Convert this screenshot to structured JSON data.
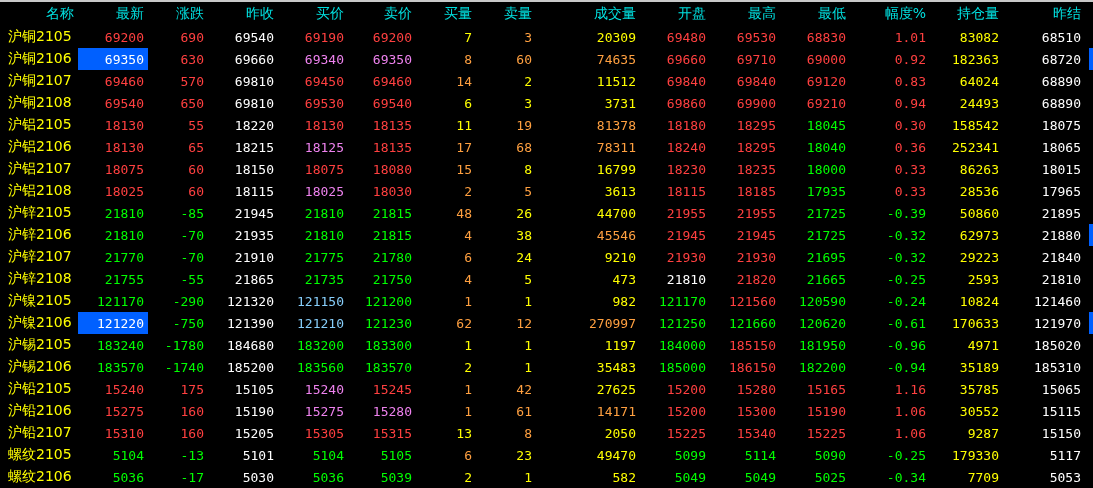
{
  "columns": [
    "名称",
    "最新",
    "涨跌",
    "昨收",
    "买价",
    "卖价",
    "买量",
    "卖量",
    "成交量",
    "开盘",
    "最高",
    "最低",
    "幅度%",
    "持仓量",
    "昨结"
  ],
  "rows": [
    {
      "name": "沪铜2105",
      "selected": false,
      "marked": false,
      "cells": [
        {
          "text": "69200",
          "color": "#ff4040"
        },
        {
          "text": "690",
          "color": "#ff4040"
        },
        {
          "text": "69540",
          "color": "#ffffff"
        },
        {
          "text": "69190",
          "color": "#ff4040"
        },
        {
          "text": "69200",
          "color": "#ff4040"
        },
        {
          "text": "7",
          "color": "#ffff00"
        },
        {
          "text": "3",
          "color": "#ffa040"
        },
        {
          "text": "20309",
          "color": "#ffff00"
        },
        {
          "text": "69480",
          "color": "#ff4040"
        },
        {
          "text": "69530",
          "color": "#ff4040"
        },
        {
          "text": "68830",
          "color": "#ff4040"
        },
        {
          "text": "1.01",
          "color": "#ff4040"
        },
        {
          "text": "83082",
          "color": "#ffff00"
        },
        {
          "text": "68510",
          "color": "#ffffff"
        }
      ]
    },
    {
      "name": "沪铜2106",
      "selected": true,
      "marked": true,
      "cells": [
        {
          "text": "69350",
          "color": "#ffffff"
        },
        {
          "text": "630",
          "color": "#ff4040"
        },
        {
          "text": "69660",
          "color": "#ffffff"
        },
        {
          "text": "69340",
          "color": "#ee82ee"
        },
        {
          "text": "69350",
          "color": "#ee82ee"
        },
        {
          "text": "8",
          "color": "#ffa040"
        },
        {
          "text": "60",
          "color": "#ffa040"
        },
        {
          "text": "74635",
          "color": "#ffa040"
        },
        {
          "text": "69660",
          "color": "#ff4040"
        },
        {
          "text": "69710",
          "color": "#ff4040"
        },
        {
          "text": "69000",
          "color": "#ff4040"
        },
        {
          "text": "0.92",
          "color": "#ff4040"
        },
        {
          "text": "182363",
          "color": "#ffff00"
        },
        {
          "text": "68720",
          "color": "#ffffff"
        }
      ]
    },
    {
      "name": "沪铜2107",
      "selected": false,
      "marked": false,
      "cells": [
        {
          "text": "69460",
          "color": "#ff4040"
        },
        {
          "text": "570",
          "color": "#ff4040"
        },
        {
          "text": "69810",
          "color": "#ffffff"
        },
        {
          "text": "69450",
          "color": "#ff4040"
        },
        {
          "text": "69460",
          "color": "#ff4040"
        },
        {
          "text": "14",
          "color": "#ffa040"
        },
        {
          "text": "2",
          "color": "#ffff00"
        },
        {
          "text": "11512",
          "color": "#ffff00"
        },
        {
          "text": "69840",
          "color": "#ff4040"
        },
        {
          "text": "69840",
          "color": "#ff4040"
        },
        {
          "text": "69120",
          "color": "#ff4040"
        },
        {
          "text": "0.83",
          "color": "#ff4040"
        },
        {
          "text": "64024",
          "color": "#ffff00"
        },
        {
          "text": "68890",
          "color": "#ffffff"
        }
      ]
    },
    {
      "name": "沪铜2108",
      "selected": false,
      "marked": false,
      "cells": [
        {
          "text": "69540",
          "color": "#ff4040"
        },
        {
          "text": "650",
          "color": "#ff4040"
        },
        {
          "text": "69810",
          "color": "#ffffff"
        },
        {
          "text": "69530",
          "color": "#ff4040"
        },
        {
          "text": "69540",
          "color": "#ff4040"
        },
        {
          "text": "6",
          "color": "#ffff00"
        },
        {
          "text": "3",
          "color": "#ffff00"
        },
        {
          "text": "3731",
          "color": "#ffff00"
        },
        {
          "text": "69860",
          "color": "#ff4040"
        },
        {
          "text": "69900",
          "color": "#ff4040"
        },
        {
          "text": "69210",
          "color": "#ff4040"
        },
        {
          "text": "0.94",
          "color": "#ff4040"
        },
        {
          "text": "24493",
          "color": "#ffff00"
        },
        {
          "text": "68890",
          "color": "#ffffff"
        }
      ]
    },
    {
      "name": "沪铝2105",
      "selected": false,
      "marked": false,
      "cells": [
        {
          "text": "18130",
          "color": "#ff4040"
        },
        {
          "text": "55",
          "color": "#ff4040"
        },
        {
          "text": "18220",
          "color": "#ffffff"
        },
        {
          "text": "18130",
          "color": "#ff4040"
        },
        {
          "text": "18135",
          "color": "#ff4040"
        },
        {
          "text": "11",
          "color": "#ffff00"
        },
        {
          "text": "19",
          "color": "#ffa040"
        },
        {
          "text": "81378",
          "color": "#ffa040"
        },
        {
          "text": "18180",
          "color": "#ff4040"
        },
        {
          "text": "18295",
          "color": "#ff4040"
        },
        {
          "text": "18045",
          "color": "#00ff00"
        },
        {
          "text": "0.30",
          "color": "#ff4040"
        },
        {
          "text": "158542",
          "color": "#ffff00"
        },
        {
          "text": "18075",
          "color": "#ffffff"
        }
      ]
    },
    {
      "name": "沪铝2106",
      "selected": false,
      "marked": false,
      "cells": [
        {
          "text": "18130",
          "color": "#ff4040"
        },
        {
          "text": "65",
          "color": "#ff4040"
        },
        {
          "text": "18215",
          "color": "#ffffff"
        },
        {
          "text": "18125",
          "color": "#ee82ee"
        },
        {
          "text": "18135",
          "color": "#ff4040"
        },
        {
          "text": "17",
          "color": "#ffa040"
        },
        {
          "text": "68",
          "color": "#ffa040"
        },
        {
          "text": "78311",
          "color": "#ffa040"
        },
        {
          "text": "18240",
          "color": "#ff4040"
        },
        {
          "text": "18295",
          "color": "#ff4040"
        },
        {
          "text": "18040",
          "color": "#00ff00"
        },
        {
          "text": "0.36",
          "color": "#ff4040"
        },
        {
          "text": "252341",
          "color": "#ffff00"
        },
        {
          "text": "18065",
          "color": "#ffffff"
        }
      ]
    },
    {
      "name": "沪铝2107",
      "selected": false,
      "marked": false,
      "cells": [
        {
          "text": "18075",
          "color": "#ff4040"
        },
        {
          "text": "60",
          "color": "#ff4040"
        },
        {
          "text": "18150",
          "color": "#ffffff"
        },
        {
          "text": "18075",
          "color": "#ff4040"
        },
        {
          "text": "18080",
          "color": "#ff4040"
        },
        {
          "text": "15",
          "color": "#ffa040"
        },
        {
          "text": "8",
          "color": "#ffff00"
        },
        {
          "text": "16799",
          "color": "#ffff00"
        },
        {
          "text": "18230",
          "color": "#ff4040"
        },
        {
          "text": "18235",
          "color": "#ff4040"
        },
        {
          "text": "18000",
          "color": "#00ff00"
        },
        {
          "text": "0.33",
          "color": "#ff4040"
        },
        {
          "text": "86263",
          "color": "#ffff00"
        },
        {
          "text": "18015",
          "color": "#ffffff"
        }
      ]
    },
    {
      "name": "沪铝2108",
      "selected": false,
      "marked": false,
      "cells": [
        {
          "text": "18025",
          "color": "#ff4040"
        },
        {
          "text": "60",
          "color": "#ff4040"
        },
        {
          "text": "18115",
          "color": "#ffffff"
        },
        {
          "text": "18025",
          "color": "#ee82ee"
        },
        {
          "text": "18030",
          "color": "#ff4040"
        },
        {
          "text": "2",
          "color": "#ffa040"
        },
        {
          "text": "5",
          "color": "#ffa040"
        },
        {
          "text": "3613",
          "color": "#ffff00"
        },
        {
          "text": "18115",
          "color": "#ff4040"
        },
        {
          "text": "18185",
          "color": "#ff4040"
        },
        {
          "text": "17935",
          "color": "#00ff00"
        },
        {
          "text": "0.33",
          "color": "#ff4040"
        },
        {
          "text": "28536",
          "color": "#ffff00"
        },
        {
          "text": "17965",
          "color": "#ffffff"
        }
      ]
    },
    {
      "name": "沪锌2105",
      "selected": false,
      "marked": false,
      "cells": [
        {
          "text": "21810",
          "color": "#00ff00"
        },
        {
          "text": "-85",
          "color": "#00ff00"
        },
        {
          "text": "21945",
          "color": "#ffffff"
        },
        {
          "text": "21810",
          "color": "#00ff00"
        },
        {
          "text": "21815",
          "color": "#00ff00"
        },
        {
          "text": "48",
          "color": "#ffa040"
        },
        {
          "text": "26",
          "color": "#ffff00"
        },
        {
          "text": "44700",
          "color": "#ffff00"
        },
        {
          "text": "21955",
          "color": "#ff4040"
        },
        {
          "text": "21955",
          "color": "#ff4040"
        },
        {
          "text": "21725",
          "color": "#00ff00"
        },
        {
          "text": "-0.39",
          "color": "#00ff00"
        },
        {
          "text": "50860",
          "color": "#ffff00"
        },
        {
          "text": "21895",
          "color": "#ffffff"
        }
      ]
    },
    {
      "name": "沪锌2106",
      "selected": false,
      "marked": true,
      "cells": [
        {
          "text": "21810",
          "color": "#00ff00"
        },
        {
          "text": "-70",
          "color": "#00ff00"
        },
        {
          "text": "21935",
          "color": "#ffffff"
        },
        {
          "text": "21810",
          "color": "#00ff00"
        },
        {
          "text": "21815",
          "color": "#00ff00"
        },
        {
          "text": "4",
          "color": "#ffa040"
        },
        {
          "text": "38",
          "color": "#ffff00"
        },
        {
          "text": "45546",
          "color": "#ffa040"
        },
        {
          "text": "21945",
          "color": "#ff4040"
        },
        {
          "text": "21945",
          "color": "#ff4040"
        },
        {
          "text": "21725",
          "color": "#00ff00"
        },
        {
          "text": "-0.32",
          "color": "#00ff00"
        },
        {
          "text": "62973",
          "color": "#ffff00"
        },
        {
          "text": "21880",
          "color": "#ffffff"
        }
      ]
    },
    {
      "name": "沪锌2107",
      "selected": false,
      "marked": false,
      "cells": [
        {
          "text": "21770",
          "color": "#00ff00"
        },
        {
          "text": "-70",
          "color": "#00ff00"
        },
        {
          "text": "21910",
          "color": "#ffffff"
        },
        {
          "text": "21775",
          "color": "#00ff00"
        },
        {
          "text": "21780",
          "color": "#00ff00"
        },
        {
          "text": "6",
          "color": "#ffa040"
        },
        {
          "text": "24",
          "color": "#ffff00"
        },
        {
          "text": "9210",
          "color": "#ffff00"
        },
        {
          "text": "21930",
          "color": "#ff4040"
        },
        {
          "text": "21930",
          "color": "#ff4040"
        },
        {
          "text": "21695",
          "color": "#00ff00"
        },
        {
          "text": "-0.32",
          "color": "#00ff00"
        },
        {
          "text": "29223",
          "color": "#ffff00"
        },
        {
          "text": "21840",
          "color": "#ffffff"
        }
      ]
    },
    {
      "name": "沪锌2108",
      "selected": false,
      "marked": false,
      "cells": [
        {
          "text": "21755",
          "color": "#00ff00"
        },
        {
          "text": "-55",
          "color": "#00ff00"
        },
        {
          "text": "21865",
          "color": "#ffffff"
        },
        {
          "text": "21735",
          "color": "#00ff00"
        },
        {
          "text": "21750",
          "color": "#00ff00"
        },
        {
          "text": "4",
          "color": "#ffa040"
        },
        {
          "text": "5",
          "color": "#ffff00"
        },
        {
          "text": "473",
          "color": "#ffff00"
        },
        {
          "text": "21810",
          "color": "#ffffff"
        },
        {
          "text": "21820",
          "color": "#ff4040"
        },
        {
          "text": "21665",
          "color": "#00ff00"
        },
        {
          "text": "-0.25",
          "color": "#00ff00"
        },
        {
          "text": "2593",
          "color": "#ffff00"
        },
        {
          "text": "21810",
          "color": "#ffffff"
        }
      ]
    },
    {
      "name": "沪镍2105",
      "selected": false,
      "marked": false,
      "cells": [
        {
          "text": "121170",
          "color": "#00ff00"
        },
        {
          "text": "-290",
          "color": "#00ff00"
        },
        {
          "text": "121320",
          "color": "#ffffff"
        },
        {
          "text": "121150",
          "color": "#87cefa"
        },
        {
          "text": "121200",
          "color": "#00ff00"
        },
        {
          "text": "1",
          "color": "#ffa040"
        },
        {
          "text": "1",
          "color": "#ffff00"
        },
        {
          "text": "982",
          "color": "#ffff00"
        },
        {
          "text": "121170",
          "color": "#00ff00"
        },
        {
          "text": "121560",
          "color": "#ff4040"
        },
        {
          "text": "120590",
          "color": "#00ff00"
        },
        {
          "text": "-0.24",
          "color": "#00ff00"
        },
        {
          "text": "10824",
          "color": "#ffff00"
        },
        {
          "text": "121460",
          "color": "#ffffff"
        }
      ]
    },
    {
      "name": "沪镍2106",
      "selected": true,
      "marked": true,
      "cells": [
        {
          "text": "121220",
          "color": "#ffffff"
        },
        {
          "text": "-750",
          "color": "#00ff00"
        },
        {
          "text": "121390",
          "color": "#ffffff"
        },
        {
          "text": "121210",
          "color": "#87cefa"
        },
        {
          "text": "121230",
          "color": "#00ff00"
        },
        {
          "text": "62",
          "color": "#ffa040"
        },
        {
          "text": "12",
          "color": "#ffa040"
        },
        {
          "text": "270997",
          "color": "#ffa040"
        },
        {
          "text": "121250",
          "color": "#00ff00"
        },
        {
          "text": "121660",
          "color": "#00ff00"
        },
        {
          "text": "120620",
          "color": "#00ff00"
        },
        {
          "text": "-0.61",
          "color": "#00ff00"
        },
        {
          "text": "170633",
          "color": "#ffff00"
        },
        {
          "text": "121970",
          "color": "#ffffff"
        }
      ]
    },
    {
      "name": "沪锡2105",
      "selected": false,
      "marked": false,
      "cells": [
        {
          "text": "183240",
          "color": "#00ff00"
        },
        {
          "text": "-1780",
          "color": "#00ff00"
        },
        {
          "text": "184680",
          "color": "#ffffff"
        },
        {
          "text": "183200",
          "color": "#00ff00"
        },
        {
          "text": "183300",
          "color": "#00ff00"
        },
        {
          "text": "1",
          "color": "#ffff00"
        },
        {
          "text": "1",
          "color": "#ffff00"
        },
        {
          "text": "1197",
          "color": "#ffff00"
        },
        {
          "text": "184000",
          "color": "#00ff00"
        },
        {
          "text": "185150",
          "color": "#ff4040"
        },
        {
          "text": "181950",
          "color": "#00ff00"
        },
        {
          "text": "-0.96",
          "color": "#00ff00"
        },
        {
          "text": "4971",
          "color": "#ffff00"
        },
        {
          "text": "185020",
          "color": "#ffffff"
        }
      ]
    },
    {
      "name": "沪锡2106",
      "selected": false,
      "marked": false,
      "cells": [
        {
          "text": "183570",
          "color": "#00ff00"
        },
        {
          "text": "-1740",
          "color": "#00ff00"
        },
        {
          "text": "185200",
          "color": "#ffffff"
        },
        {
          "text": "183560",
          "color": "#00ff00"
        },
        {
          "text": "183570",
          "color": "#00ff00"
        },
        {
          "text": "2",
          "color": "#ffff00"
        },
        {
          "text": "1",
          "color": "#ffff00"
        },
        {
          "text": "35483",
          "color": "#ffff00"
        },
        {
          "text": "185000",
          "color": "#00ff00"
        },
        {
          "text": "186150",
          "color": "#ff4040"
        },
        {
          "text": "182200",
          "color": "#00ff00"
        },
        {
          "text": "-0.94",
          "color": "#00ff00"
        },
        {
          "text": "35189",
          "color": "#ffff00"
        },
        {
          "text": "185310",
          "color": "#ffffff"
        }
      ]
    },
    {
      "name": "沪铅2105",
      "selected": false,
      "marked": false,
      "cells": [
        {
          "text": "15240",
          "color": "#ff4040"
        },
        {
          "text": "175",
          "color": "#ff4040"
        },
        {
          "text": "15105",
          "color": "#ffffff"
        },
        {
          "text": "15240",
          "color": "#ee82ee"
        },
        {
          "text": "15245",
          "color": "#ff4040"
        },
        {
          "text": "1",
          "color": "#ffa040"
        },
        {
          "text": "42",
          "color": "#ffa040"
        },
        {
          "text": "27625",
          "color": "#ffff00"
        },
        {
          "text": "15200",
          "color": "#ff4040"
        },
        {
          "text": "15280",
          "color": "#ff4040"
        },
        {
          "text": "15165",
          "color": "#ff4040"
        },
        {
          "text": "1.16",
          "color": "#ff4040"
        },
        {
          "text": "35785",
          "color": "#ffff00"
        },
        {
          "text": "15065",
          "color": "#ffffff"
        }
      ]
    },
    {
      "name": "沪铅2106",
      "selected": false,
      "marked": false,
      "cells": [
        {
          "text": "15275",
          "color": "#ff4040"
        },
        {
          "text": "160",
          "color": "#ff4040"
        },
        {
          "text": "15190",
          "color": "#ffffff"
        },
        {
          "text": "15275",
          "color": "#ee82ee"
        },
        {
          "text": "15280",
          "color": "#ee82ee"
        },
        {
          "text": "1",
          "color": "#ffa040"
        },
        {
          "text": "61",
          "color": "#ffa040"
        },
        {
          "text": "14171",
          "color": "#ffa040"
        },
        {
          "text": "15200",
          "color": "#ff4040"
        },
        {
          "text": "15300",
          "color": "#ff4040"
        },
        {
          "text": "15190",
          "color": "#ff4040"
        },
        {
          "text": "1.06",
          "color": "#ff4040"
        },
        {
          "text": "30552",
          "color": "#ffff00"
        },
        {
          "text": "15115",
          "color": "#ffffff"
        }
      ]
    },
    {
      "name": "沪铅2107",
      "selected": false,
      "marked": false,
      "cells": [
        {
          "text": "15310",
          "color": "#ff4040"
        },
        {
          "text": "160",
          "color": "#ff4040"
        },
        {
          "text": "15205",
          "color": "#ffffff"
        },
        {
          "text": "15305",
          "color": "#ff4040"
        },
        {
          "text": "15315",
          "color": "#ff4040"
        },
        {
          "text": "13",
          "color": "#ffff00"
        },
        {
          "text": "8",
          "color": "#ffa040"
        },
        {
          "text": "2050",
          "color": "#ffff00"
        },
        {
          "text": "15225",
          "color": "#ff4040"
        },
        {
          "text": "15340",
          "color": "#ff4040"
        },
        {
          "text": "15225",
          "color": "#ff4040"
        },
        {
          "text": "1.06",
          "color": "#ff4040"
        },
        {
          "text": "9287",
          "color": "#ffff00"
        },
        {
          "text": "15150",
          "color": "#ffffff"
        }
      ]
    },
    {
      "name": "螺纹2105",
      "selected": false,
      "marked": false,
      "cells": [
        {
          "text": "5104",
          "color": "#00ff00"
        },
        {
          "text": "-13",
          "color": "#00ff00"
        },
        {
          "text": "5101",
          "color": "#ffffff"
        },
        {
          "text": "5104",
          "color": "#00ff00"
        },
        {
          "text": "5105",
          "color": "#00ff00"
        },
        {
          "text": "6",
          "color": "#ffa040"
        },
        {
          "text": "23",
          "color": "#ffff00"
        },
        {
          "text": "49470",
          "color": "#ffff00"
        },
        {
          "text": "5099",
          "color": "#00ff00"
        },
        {
          "text": "5114",
          "color": "#00ff00"
        },
        {
          "text": "5090",
          "color": "#00ff00"
        },
        {
          "text": "-0.25",
          "color": "#00ff00"
        },
        {
          "text": "179330",
          "color": "#ffff00"
        },
        {
          "text": "5117",
          "color": "#ffffff"
        }
      ]
    },
    {
      "name": "螺纹2106",
      "selected": false,
      "marked": false,
      "cells": [
        {
          "text": "5036",
          "color": "#00ff00"
        },
        {
          "text": "-17",
          "color": "#00ff00"
        },
        {
          "text": "5030",
          "color": "#ffffff"
        },
        {
          "text": "5036",
          "color": "#00ff00"
        },
        {
          "text": "5039",
          "color": "#00ff00"
        },
        {
          "text": "2",
          "color": "#ffff00"
        },
        {
          "text": "1",
          "color": "#ffff00"
        },
        {
          "text": "582",
          "color": "#ffff00"
        },
        {
          "text": "5049",
          "color": "#00ff00"
        },
        {
          "text": "5049",
          "color": "#00ff00"
        },
        {
          "text": "5025",
          "color": "#00ff00"
        },
        {
          "text": "-0.34",
          "color": "#00ff00"
        },
        {
          "text": "7709",
          "color": "#ffff00"
        },
        {
          "text": "5053",
          "color": "#ffffff"
        }
      ]
    }
  ]
}
